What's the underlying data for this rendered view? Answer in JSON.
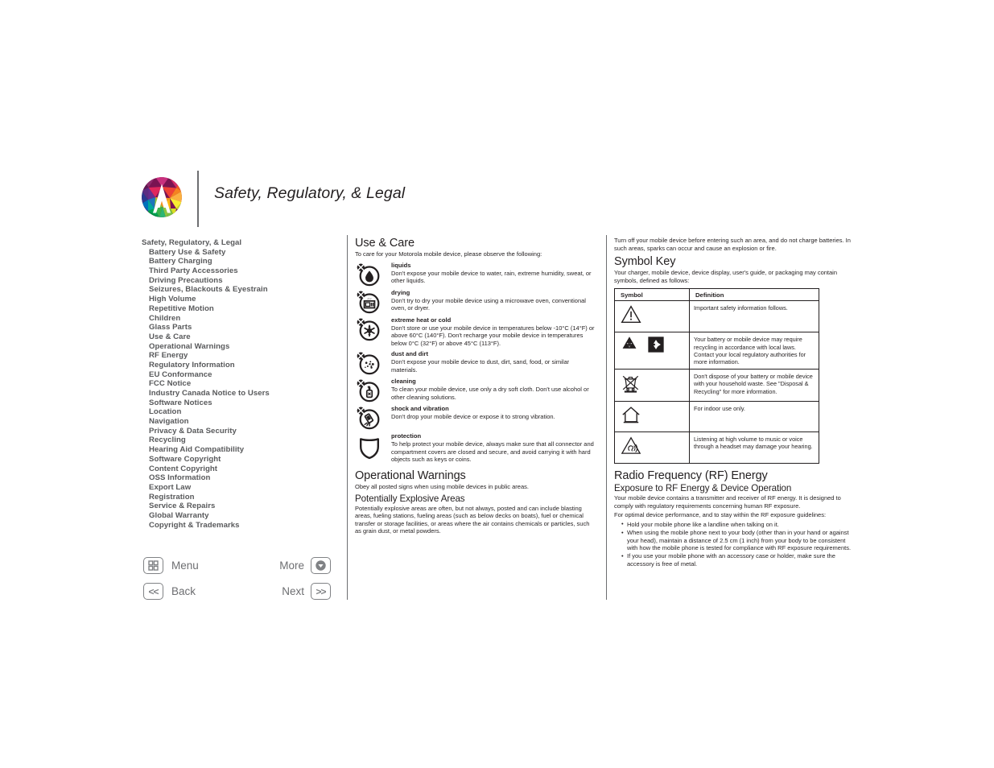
{
  "header": {
    "title": "Safety, Regulatory, & Legal",
    "logo_icon": "motorola-logo-icon"
  },
  "toc": {
    "items": [
      {
        "label": "Safety, Regulatory, & Legal",
        "level": 0
      },
      {
        "label": "Battery Use & Safety",
        "level": 1
      },
      {
        "label": "Battery Charging",
        "level": 1
      },
      {
        "label": "Third Party Accessories",
        "level": 1
      },
      {
        "label": "Driving Precautions",
        "level": 1
      },
      {
        "label": "Seizures, Blackouts & Eyestrain",
        "level": 1
      },
      {
        "label": "High Volume",
        "level": 1
      },
      {
        "label": "Repetitive Motion",
        "level": 1
      },
      {
        "label": "Children",
        "level": 1
      },
      {
        "label": "Glass Parts",
        "level": 1
      },
      {
        "label": "Use & Care",
        "level": 1
      },
      {
        "label": "Operational Warnings",
        "level": 1
      },
      {
        "label": "RF Energy",
        "level": 1
      },
      {
        "label": "Regulatory Information",
        "level": 1
      },
      {
        "label": "EU Conformance",
        "level": 1
      },
      {
        "label": "FCC Notice",
        "level": 1
      },
      {
        "label": "Industry Canada Notice to Users",
        "level": 1
      },
      {
        "label": "Software Notices",
        "level": 1
      },
      {
        "label": "Location",
        "level": 1
      },
      {
        "label": "Navigation",
        "level": 1
      },
      {
        "label": "Privacy & Data Security",
        "level": 1
      },
      {
        "label": "Recycling",
        "level": 1
      },
      {
        "label": "Hearing Aid Compatibility",
        "level": 1
      },
      {
        "label": "Software Copyright",
        "level": 1
      },
      {
        "label": "Content Copyright",
        "level": 1
      },
      {
        "label": "OSS Information",
        "level": 1
      },
      {
        "label": "Export Law",
        "level": 1
      },
      {
        "label": "Registration",
        "level": 1
      },
      {
        "label": "Service & Repairs",
        "level": 1
      },
      {
        "label": "Global Warranty",
        "level": 1
      },
      {
        "label": "Copyright & Trademarks",
        "level": 1
      }
    ]
  },
  "nav": {
    "menu_label": "Menu",
    "menu_icon": "grid-menu-icon",
    "more_label": "More",
    "more_icon": "chevron-down-circle-icon",
    "back_label": "Back",
    "back_icon": "double-chevron-left-icon",
    "back_glyph": "<<",
    "next_label": "Next",
    "next_icon": "double-chevron-right-icon",
    "next_glyph": ">>"
  },
  "middle": {
    "use_care_heading": "Use & Care",
    "use_care_intro": "To care for your Motorola mobile device, please observe the following:",
    "care_items": [
      {
        "icon": "liquids-no-water-icon",
        "title": "liquids",
        "text": "Don't expose your mobile device to water, rain, extreme humidity, sweat, or other liquids."
      },
      {
        "icon": "drying-no-microwave-icon",
        "title": "drying",
        "text": "Don't try to dry your mobile device using a microwave oven, conventional oven, or dryer."
      },
      {
        "icon": "extreme-temperature-icon",
        "title": "extreme heat or cold",
        "text": "Don't store or use your mobile device in temperatures below -10°C (14°F) or above 60°C (140°F). Don't recharge your mobile device in temperatures below 0°C (32°F) or above 45°C (113°F)."
      },
      {
        "icon": "dust-and-dirt-icon",
        "title": "dust and dirt",
        "text": "Don't expose your mobile device to dust, dirt, sand, food, or similar materials."
      },
      {
        "icon": "cleaning-no-solvent-icon",
        "title": "cleaning",
        "text": "To clean your mobile device, use only a dry soft cloth. Don't use alcohol or other cleaning solutions."
      },
      {
        "icon": "shock-and-vibration-icon",
        "title": "shock and vibration",
        "text": "Don't drop your mobile device or expose it to strong vibration."
      },
      {
        "icon": "protection-shield-icon",
        "title": "protection",
        "text": "To help protect your mobile device, always make sure that all connector and compartment covers are closed and secure, and avoid carrying it with hard objects such as keys or coins."
      }
    ],
    "operational_warnings_heading": "Operational Warnings",
    "operational_warnings_text": "Obey all posted signs when using mobile devices in public areas.",
    "explosive_heading": "Potentially Explosive Areas",
    "explosive_text": "Potentially explosive areas are often, but not always, posted and can include blasting areas, fueling stations, fueling areas (such as below decks on boats), fuel or chemical transfer or storage facilities, or areas where the air contains chemicals or particles, such as grain dust, or metal powders."
  },
  "right": {
    "explosive_continued": "Turn off your mobile device before entering such an area, and do not charge batteries. In such areas, sparks can occur and cause an explosion or fire.",
    "symbol_key_heading": "Symbol Key",
    "symbol_key_intro": "Your charger, mobile device, device display, user's guide, or packaging may contain symbols, defined as follows:",
    "table": {
      "columns": [
        "Symbol",
        "Definition"
      ],
      "rows": [
        {
          "icons": [
            "warning-triangle-icon"
          ],
          "definition": "Important safety information follows."
        },
        {
          "icons": [
            "recycling-loop-icon",
            "battery-recycling-box-icon"
          ],
          "definition": "Your battery or mobile device may require recycling in accordance with local laws. Contact your local regulatory authorities for more information."
        },
        {
          "icons": [
            "crossed-out-wheelie-bin-icon"
          ],
          "definition": "Don't dispose of your battery or mobile device with your household waste. See \"Disposal & Recycling\" for more information."
        },
        {
          "icons": [
            "indoor-use-house-icon"
          ],
          "definition": "For indoor use only."
        },
        {
          "icons": [
            "high-volume-ear-icon"
          ],
          "definition": "Listening at high volume to music or voice through a headset may damage your hearing."
        }
      ]
    },
    "rf_heading": "Radio Frequency (RF) Energy",
    "rf_sub": "Exposure to RF Energy & Device Operation",
    "rf_para_1": "Your mobile device contains a transmitter and receiver of RF energy. It is designed to comply with regulatory requirements concerning human RF exposure.",
    "rf_para_2": "For optimal device performance, and to stay within the RF exposure guidelines:",
    "rf_bullets": [
      "Hold your mobile phone like a landline when talking on it.",
      "When using the mobile phone next to your body (other than in your hand or against your head), maintain a distance of 2.5 cm (1 inch) from your body to be consistent with how the mobile phone is tested for compliance with RF exposure requirements.",
      "If you use your mobile phone with an accessory case or holder, make sure the accessory is free of metal."
    ]
  },
  "colors": {
    "text": "#231f20",
    "muted": "#58595b",
    "rule": "#6d6e71",
    "nav_border": "#808285"
  }
}
